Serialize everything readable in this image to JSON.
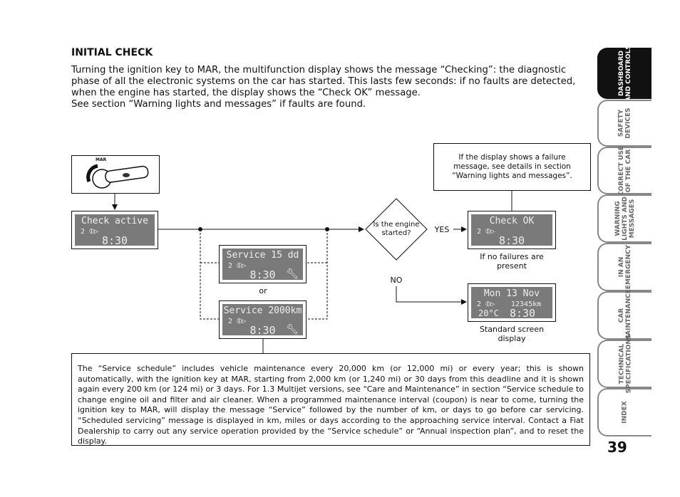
{
  "heading": "INITIAL CHECK",
  "intro": [
    "Turning the ignition key to MAR, the multifunction display shows the message “Checking”: the diagnostic phase of all the electronic systems on the car has started. This lasts few seconds: if no faults are detected, when the engine has started, the display shows the “Check OK” message.",
    "See section “Warning lights and messages” if faults are found."
  ],
  "key_label": "MAR",
  "displays": {
    "check_active": {
      "line1": "Check active",
      "line2": "2 ⦶▷",
      "time": "8:30"
    },
    "service_days": {
      "line1": "Service  15 dd",
      "line2": "2 ⦶▷",
      "time": "8:30",
      "icon": "wrench-icon"
    },
    "service_km": {
      "line1": "Service 2000km",
      "line2": "2 ⦶▷",
      "time": "8:30",
      "icon": "wrench-icon"
    },
    "check_ok": {
      "line1": "Check  OK",
      "line2": "2 ⦶▷",
      "time": "8:30"
    },
    "standard": {
      "line1": "Mon 13 Nov",
      "line2": "2 ⦶▷",
      "odometer": "12345km",
      "temp": "20°C",
      "time": "8:30"
    }
  },
  "or_label": "or",
  "decision": "Is the engine started?",
  "yes": "YES",
  "no": "NO",
  "failure_note": "If the display shows a failure message, see details in section “Warning lights and messages”.",
  "no_failures_caption": "If no failures are present",
  "standard_caption": "Standard screen display",
  "service_note": "The “Service schedule” includes vehicle maintenance every 20,000 km (or 12,000 mi) or every year; this is shown automatically, with the ignition key at MAR, starting from 2,000 km (or 1,240 mi) or 30 days from this deadline and it is shown again every 200 km (or 124 mi) or 3 days. For 1.3 Multijet versions, see “Care and Maintenance” in section “Service schedule to change engine oil and filter and air cleaner. When a programmed maintenance interval (coupon) is near to come, turning the ignition key to MAR, will display the message “Service” followed by the number of km, or days to go before car servicing. “Scheduled servicing” message is displayed in km, miles or days according to the approaching service interval. Contact a Fiat Dealership to carry out any service operation provided by the “Service schedule” or “Annual inspection plan”, and to reset the display.",
  "tabs": [
    {
      "label": "DASHBOARD\nAND CONTROLS",
      "active": true
    },
    {
      "label": "SAFETY\nDEVICES"
    },
    {
      "label": "CORRECT USE\nOF THE CAR"
    },
    {
      "label": "WARNING\nLIGHTS AND\nMESSAGES"
    },
    {
      "label": "IN AN\nEMERGENCY"
    },
    {
      "label": "CAR\nMAINTENANCE"
    },
    {
      "label": "TECHNICAL\nSPECIFICATIONS"
    },
    {
      "label": "INDEX"
    }
  ],
  "page_number": "39"
}
